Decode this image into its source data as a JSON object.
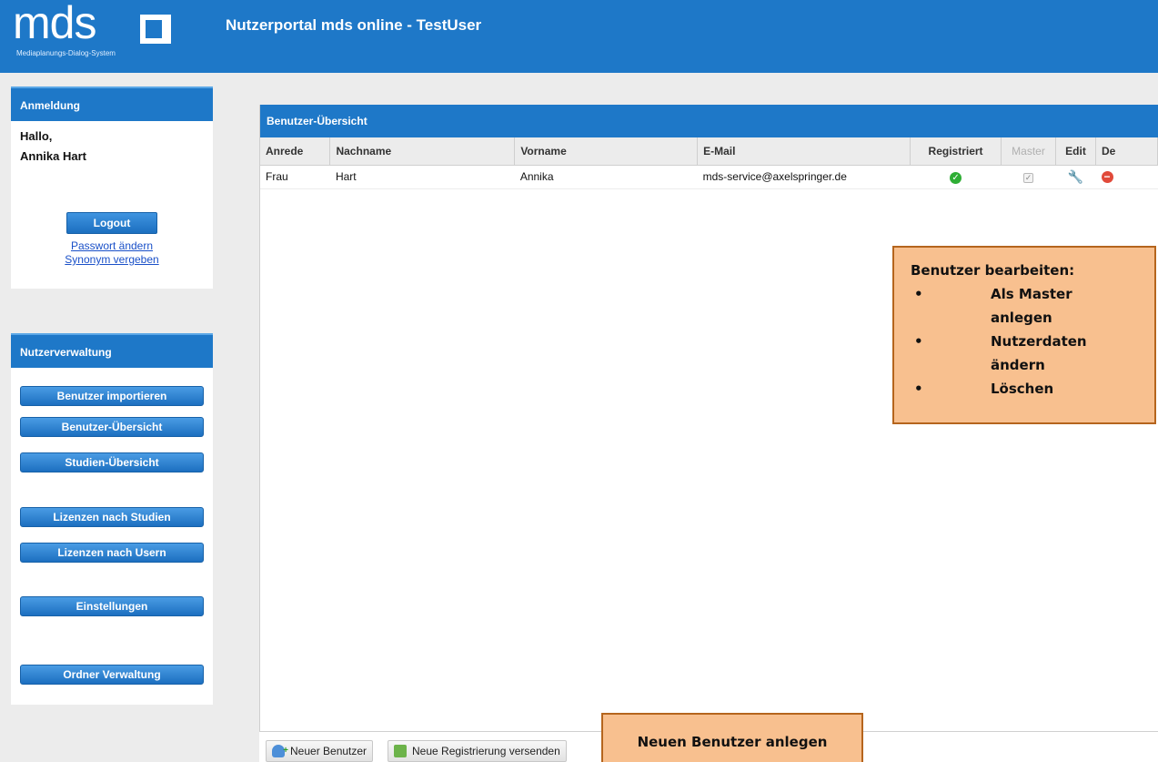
{
  "header": {
    "logo_text": "mds",
    "logo_subtitle": "Mediaplanungs-Dialog-System",
    "title": "Nutzerportal mds online - TestUser"
  },
  "login_panel": {
    "heading": "Anmeldung",
    "greeting": "Hallo,",
    "user_name": "Annika Hart",
    "logout_label": "Logout",
    "change_password_link": "Passwort ändern",
    "synonym_link": "Synonym vergeben"
  },
  "nav_panel": {
    "heading": "Nutzerverwaltung",
    "items": [
      {
        "label": "Benutzer importieren"
      },
      {
        "label": "Benutzer-Übersicht"
      },
      {
        "label": "Studien-Übersicht"
      },
      {
        "label": "Lizenzen nach Studien"
      },
      {
        "label": "Lizenzen nach Usern"
      },
      {
        "label": "Einstellungen"
      },
      {
        "label": "Ordner Verwaltung"
      }
    ]
  },
  "main": {
    "heading": "Benutzer-Übersicht",
    "columns": [
      "Anrede",
      "Nachname",
      "Vorname",
      "E-Mail",
      "Registriert",
      "Master",
      "Edit",
      "De"
    ],
    "rows": [
      {
        "anrede": "Frau",
        "nachname": "Hart",
        "vorname": "Annika",
        "email": "mds-service@axelspringer.de",
        "registriert": true,
        "master": true
      }
    ]
  },
  "toolbar": {
    "new_user_label": "Neuer Benutzer",
    "send_registration_label": "Neue Registrierung versenden"
  },
  "callouts": {
    "edit_title": "Benutzer bearbeiten:",
    "edit_items": [
      "Als Master anlegen",
      "Nutzerdaten ändern",
      "Löschen"
    ],
    "new_user": "Neuen Benutzer anlegen"
  },
  "icons": {
    "registered": "check-circle-icon",
    "master": "checkbox-icon",
    "edit": "wrench-icon",
    "delete": "delete-circle-icon",
    "new_user": "add-user-icon",
    "send_registration": "mail-send-icon"
  },
  "colors": {
    "brand_blue": "#1e78c8",
    "callout_fill": "#f8c08f",
    "callout_border": "#b5651d",
    "success_green": "#2fae35",
    "delete_red": "#e14a3a"
  }
}
